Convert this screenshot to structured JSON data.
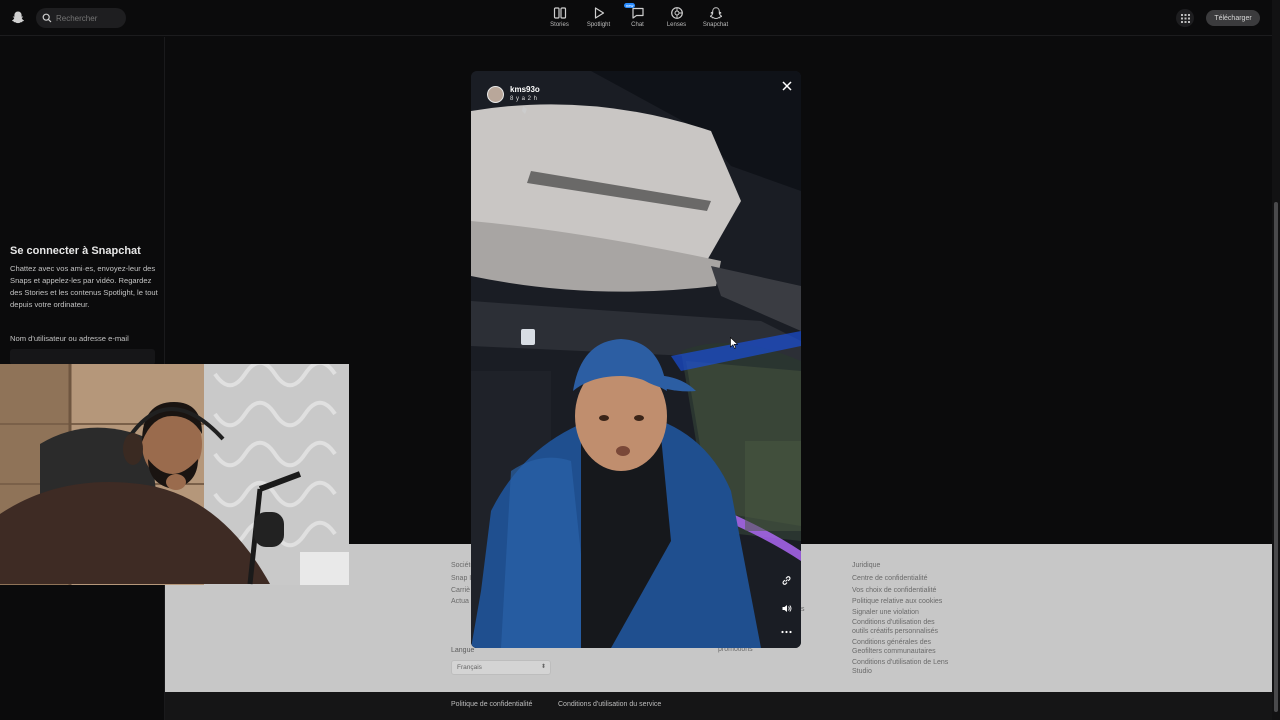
{
  "header": {
    "search_placeholder": "Rechercher",
    "nav": [
      {
        "label": "Stories",
        "icon": "stories-icon"
      },
      {
        "label": "Spotlight",
        "icon": "spotlight-play-icon"
      },
      {
        "label": "Chat",
        "icon": "chat-icon",
        "badge": "new"
      },
      {
        "label": "Lenses",
        "icon": "lenses-icon"
      },
      {
        "label": "Snapchat",
        "icon": "snapchat-ghost-icon"
      }
    ],
    "download_label": "Télécharger"
  },
  "login": {
    "title": "Se connecter à Snapchat",
    "description": "Chattez avec vos ami·es, envoyez-leur des Snaps et appelez-les par vidéo. Regardez des Stories et les contenus Spotlight, le tout depuis votre ordinateur.",
    "username_label": "Nom d'utilisateur ou adresse e-mail"
  },
  "story": {
    "username": "kms93o",
    "time": "8 y a 2 h"
  },
  "footer": {
    "company": {
      "head": "Société",
      "links": [
        "Snap I",
        "Carriè",
        "Actua"
      ]
    },
    "middle": {
      "links": [
        "s",
        "promotions"
      ]
    },
    "legal": {
      "head": "Juridique",
      "links": [
        "Centre de confidentialité",
        "Vos choix de confidentialité",
        "Politique relative aux cookies",
        "Signaler une violation",
        "Conditions d'utilisation des outils créatifs personnalisés",
        "Conditions générales des Geofilters communautaires",
        "Conditions d'utilisation de Lens Studio"
      ]
    },
    "language_label": "Langue",
    "language_value": "Français",
    "bottom_links": [
      "Politique de confidentialité",
      "Conditions d'utilisation du service"
    ]
  },
  "colors": {
    "background": "#0b0b0c",
    "footer": "#c7c7c7",
    "jacket": "#1f4f8f"
  }
}
